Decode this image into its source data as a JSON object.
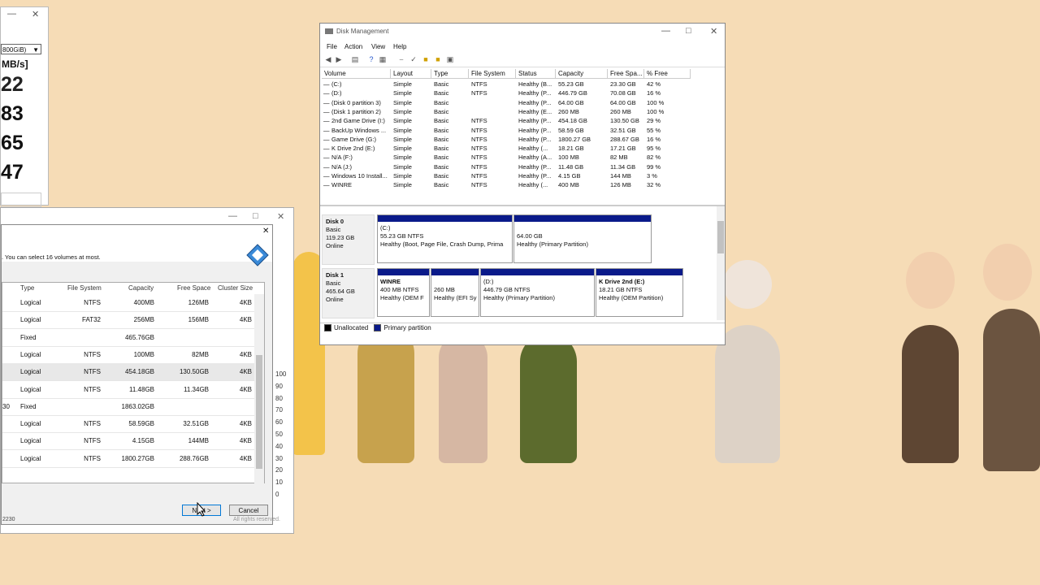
{
  "bench": {
    "drive_select": "800GiB)",
    "unit": "MB/s]",
    "values": [
      "22",
      "83",
      "65",
      "47"
    ]
  },
  "wizard": {
    "instruction": ". You can select 16 volumes at most.",
    "columns": [
      "Type",
      "File System",
      "Capacity",
      "Free Space",
      "Cluster Size"
    ],
    "rows": [
      {
        "type": "Logical",
        "fs": "NTFS",
        "capacity": "400MB",
        "free": "126MB",
        "cluster": "4KB"
      },
      {
        "type": "Logical",
        "fs": "FAT32",
        "capacity": "256MB",
        "free": "156MB",
        "cluster": "4KB"
      },
      {
        "type": "Fixed",
        "fs": "",
        "capacity": "465.76GB",
        "free": "",
        "cluster": ""
      },
      {
        "type": "Logical",
        "fs": "NTFS",
        "capacity": "100MB",
        "free": "82MB",
        "cluster": "4KB"
      },
      {
        "type": "Logical",
        "fs": "NTFS",
        "capacity": "454.18GB",
        "free": "130.50GB",
        "cluster": "4KB"
      },
      {
        "type": "Logical",
        "fs": "NTFS",
        "capacity": "11.48GB",
        "free": "11.34GB",
        "cluster": "4KB"
      },
      {
        "type": "Fixed",
        "fs": "",
        "capacity": "1863.02GB",
        "free": "",
        "cluster": "",
        "prefix": "30"
      },
      {
        "type": "Logical",
        "fs": "NTFS",
        "capacity": "58.59GB",
        "free": "32.51GB",
        "cluster": "4KB"
      },
      {
        "type": "Logical",
        "fs": "NTFS",
        "capacity": "4.15GB",
        "free": "144MB",
        "cluster": "4KB"
      },
      {
        "type": "Logical",
        "fs": "NTFS",
        "capacity": "1800.27GB",
        "free": "288.76GB",
        "cluster": "4KB"
      }
    ],
    "next_label": "Next >",
    "cancel_label": "Cancel",
    "rights": "All rights reserved.",
    "footer_code": "2230",
    "axis_ticks": [
      "100",
      "90",
      "80",
      "70",
      "60",
      "50",
      "40",
      "30",
      "20",
      "10",
      "0"
    ]
  },
  "dm": {
    "title": "Disk Management",
    "menu": [
      "File",
      "Action",
      "View",
      "Help"
    ],
    "columns": [
      "Volume",
      "Layout",
      "Type",
      "File System",
      "Status",
      "Capacity",
      "Free Spa...",
      "% Free"
    ],
    "volumes": [
      {
        "v": "(C:)",
        "l": "Simple",
        "t": "Basic",
        "fs": "NTFS",
        "s": "Healthy (B...",
        "c": "55.23 GB",
        "f": "23.30 GB",
        "p": "42 %"
      },
      {
        "v": "(D:)",
        "l": "Simple",
        "t": "Basic",
        "fs": "NTFS",
        "s": "Healthy (P...",
        "c": "446.79 GB",
        "f": "70.08 GB",
        "p": "16 %"
      },
      {
        "v": "(Disk 0 partition 3)",
        "l": "Simple",
        "t": "Basic",
        "fs": "",
        "s": "Healthy (P...",
        "c": "64.00 GB",
        "f": "64.00 GB",
        "p": "100 %"
      },
      {
        "v": "(Disk 1 partition 2)",
        "l": "Simple",
        "t": "Basic",
        "fs": "",
        "s": "Healthy (E...",
        "c": "260 MB",
        "f": "260 MB",
        "p": "100 %"
      },
      {
        "v": "2nd Game Drive (I:)",
        "l": "Simple",
        "t": "Basic",
        "fs": "NTFS",
        "s": "Healthy (P...",
        "c": "454.18 GB",
        "f": "130.50 GB",
        "p": "29 %"
      },
      {
        "v": "BackUp Windows ...",
        "l": "Simple",
        "t": "Basic",
        "fs": "NTFS",
        "s": "Healthy (P...",
        "c": "58.59 GB",
        "f": "32.51 GB",
        "p": "55 %"
      },
      {
        "v": "Game Drive (G:)",
        "l": "Simple",
        "t": "Basic",
        "fs": "NTFS",
        "s": "Healthy (P...",
        "c": "1800.27 GB",
        "f": "288.67 GB",
        "p": "16 %"
      },
      {
        "v": "K Drive 2nd (E:)",
        "l": "Simple",
        "t": "Basic",
        "fs": "NTFS",
        "s": "Healthy (...",
        "c": "18.21 GB",
        "f": "17.21 GB",
        "p": "95 %"
      },
      {
        "v": "N/A (F:)",
        "l": "Simple",
        "t": "Basic",
        "fs": "NTFS",
        "s": "Healthy (A...",
        "c": "100 MB",
        "f": "82 MB",
        "p": "82 %"
      },
      {
        "v": "N/A (J:)",
        "l": "Simple",
        "t": "Basic",
        "fs": "NTFS",
        "s": "Healthy (P...",
        "c": "11.48 GB",
        "f": "11.34 GB",
        "p": "99 %"
      },
      {
        "v": "Windows 10 Install...",
        "l": "Simple",
        "t": "Basic",
        "fs": "NTFS",
        "s": "Healthy (P...",
        "c": "4.15 GB",
        "f": "144 MB",
        "p": "3 %"
      },
      {
        "v": "WINRE",
        "l": "Simple",
        "t": "Basic",
        "fs": "NTFS",
        "s": "Healthy (...",
        "c": "400 MB",
        "f": "126 MB",
        "p": "32 %"
      }
    ],
    "disk0": {
      "name": "Disk 0",
      "type": "Basic",
      "size": "119.23 GB",
      "state": "Online",
      "p1": {
        "name": "(C:)",
        "size": "55.23 GB NTFS",
        "status": "Healthy (Boot, Page File, Crash Dump, Prima"
      },
      "p2": {
        "name": "",
        "size": "64.00 GB",
        "status": "Healthy (Primary Partition)"
      }
    },
    "disk1": {
      "name": "Disk 1",
      "type": "Basic",
      "size": "465.64 GB",
      "state": "Online",
      "p1": {
        "name": "WINRE",
        "size": "400 MB NTFS",
        "status": "Healthy (OEM F"
      },
      "p2": {
        "name": "",
        "size": "260 MB",
        "status": "Healthy (EFI Sy"
      },
      "p3": {
        "name": "(D:)",
        "size": "446.79 GB NTFS",
        "status": "Healthy (Primary Partition)"
      },
      "p4": {
        "name": "K Drive 2nd  (E:)",
        "size": "18.21 GB NTFS",
        "status": "Healthy (OEM Partition)"
      }
    },
    "legend": {
      "unallocated": "Unallocated",
      "primary": "Primary partition"
    }
  },
  "colors": {
    "desktop": "#f6dcb6",
    "primary_partition": "#0a1a8a",
    "accent": "#0078d7"
  }
}
